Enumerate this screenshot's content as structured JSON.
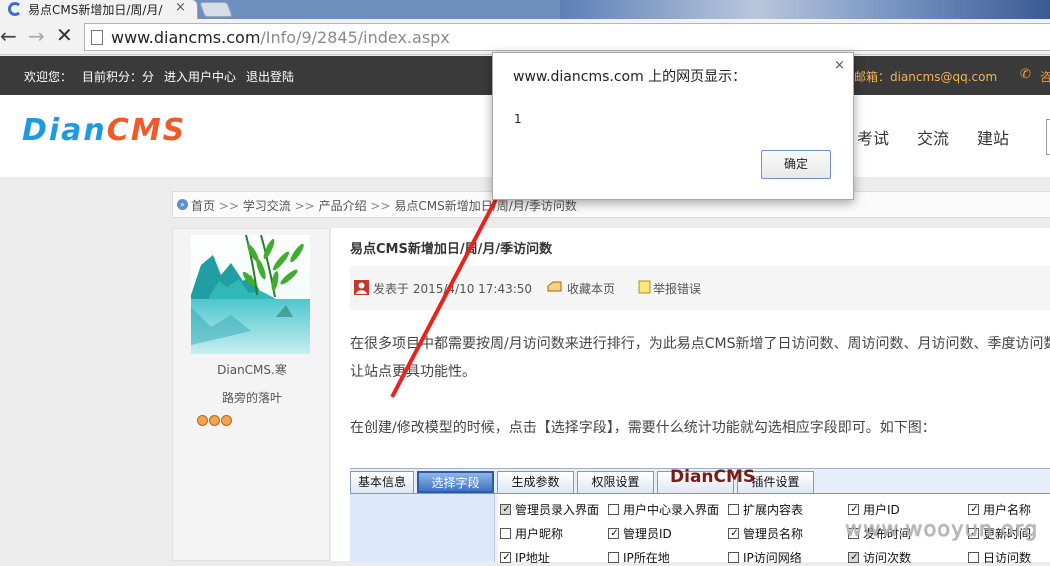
{
  "browser": {
    "tab_title": "易点CMS新增加日/周/月/",
    "tab_close": "×",
    "url_host": "www.diancms.com",
    "url_path": "/Info/9/2845/index.aspx"
  },
  "topbar": {
    "welcome": "欢迎您：",
    "points": "目前积分：分",
    "user_center": "进入用户中心",
    "logout": "退出登陆",
    "email": "询邮箱：diancms@qq.com",
    "phone_partial": "咨"
  },
  "header": {
    "logo_part1": "Dian",
    "logo_part2": "CMS",
    "nav": [
      "考试",
      "交流",
      "建站"
    ]
  },
  "breadcrumb": {
    "home": "首页",
    "sep": ">>",
    "items": [
      "学习交流",
      "产品介绍",
      "易点CMS新增加日/周/月/季访问数"
    ]
  },
  "sidebar": {
    "username": "DianCMS.寒",
    "signature": "路旁的落叶"
  },
  "article": {
    "title": "易点CMS新增加日/周/月/季访问数",
    "posted": "发表于 2015/4/10 17:43:50",
    "favorite": "收藏本页",
    "report": "举报错误",
    "paragraph1": "在很多项目中都需要按周/月访问数来进行排行，为此易点CMS新增了日访问数、周访问数、月访问数、季度访问数",
    "paragraph2": "让站点更具功能性。",
    "paragraph3": "在创建/修改模型的时候，点击【选择字段】，需要什么统计功能就勾选相应字段即可。如下图："
  },
  "screenshot": {
    "tabs": [
      "基本信息",
      "选择字段",
      "生成参数",
      "权限设置",
      "插件设置"
    ],
    "overlay_text": "DianCMS",
    "checkboxes": [
      {
        "label": "管理员录入界面",
        "checked": true,
        "dim": true
      },
      {
        "label": "用户中心录入界面",
        "checked": false
      },
      {
        "label": "扩展内容表",
        "checked": false
      },
      {
        "label": "用户ID",
        "checked": true
      },
      {
        "label": "用户名称",
        "checked": true
      },
      {
        "label": "用户昵称",
        "checked": false
      },
      {
        "label": "管理员ID",
        "checked": true
      },
      {
        "label": "管理员名称",
        "checked": true
      },
      {
        "label": "发布时间",
        "checked": false
      },
      {
        "label": "更新时间",
        "checked": true
      },
      {
        "label": "IP地址",
        "checked": true
      },
      {
        "label": "IP所在地",
        "checked": false
      },
      {
        "label": "IP访问网络",
        "checked": false
      },
      {
        "label": "访问次数",
        "checked": true,
        "dim": true
      },
      {
        "label": "日访问数",
        "checked": false
      }
    ]
  },
  "watermark": "www.wooyun.org",
  "dialog": {
    "title": "www.diancms.com 上的网页显示：",
    "close": "×",
    "message": "1",
    "ok": "确定"
  },
  "colors": {
    "topbar_bg": "#3a3a3a",
    "accent_orange": "#f0a033",
    "logo_blue": "#1e9be0",
    "logo_red": "#f05a28",
    "arrow_red": "#e8231c"
  }
}
